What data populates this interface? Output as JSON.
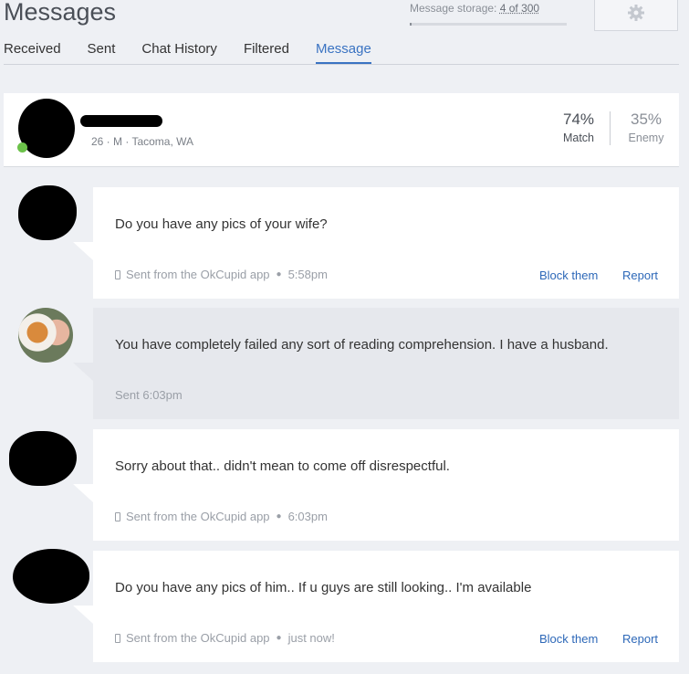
{
  "header": {
    "title": "Messages",
    "storage_label": "Message storage:",
    "storage_count": "4 of 300",
    "storage_fraction": 0.013,
    "settings_icon": "gear-icon"
  },
  "tabs": [
    {
      "label": "Received",
      "active": false
    },
    {
      "label": "Sent",
      "active": false
    },
    {
      "label": "Chat History",
      "active": false
    },
    {
      "label": "Filtered",
      "active": false
    },
    {
      "label": "Message",
      "active": true
    }
  ],
  "profile": {
    "meta": "26 · M · Tacoma, WA",
    "online_color": "#6cc24a",
    "match_value": "74%",
    "match_label": "Match",
    "enemy_value": "35%",
    "enemy_label": "Enemy"
  },
  "messages": [
    {
      "from": "them",
      "text": "Do you have any pics of your wife?",
      "source": "Sent from the OkCupid app",
      "time": "5:58pm",
      "block_label": "Block them",
      "report_label": "Report"
    },
    {
      "from": "me",
      "text": "You have completely failed any sort of reading comprehension. I have a husband.",
      "sent_label": "Sent 6:03pm"
    },
    {
      "from": "them",
      "text": "Sorry about that.. didn't mean to come off disrespectful.",
      "source": "Sent from the OkCupid app",
      "time": "6:03pm"
    },
    {
      "from": "them",
      "text": "Do you have any pics of him.. If u guys are still looking.. I'm available",
      "source": "Sent from the OkCupid app",
      "time": "just now!",
      "block_label": "Block them",
      "report_label": "Report"
    }
  ],
  "colors": {
    "accent": "#3a73c2",
    "link": "#2d68b8",
    "background": "#eef0f4"
  }
}
